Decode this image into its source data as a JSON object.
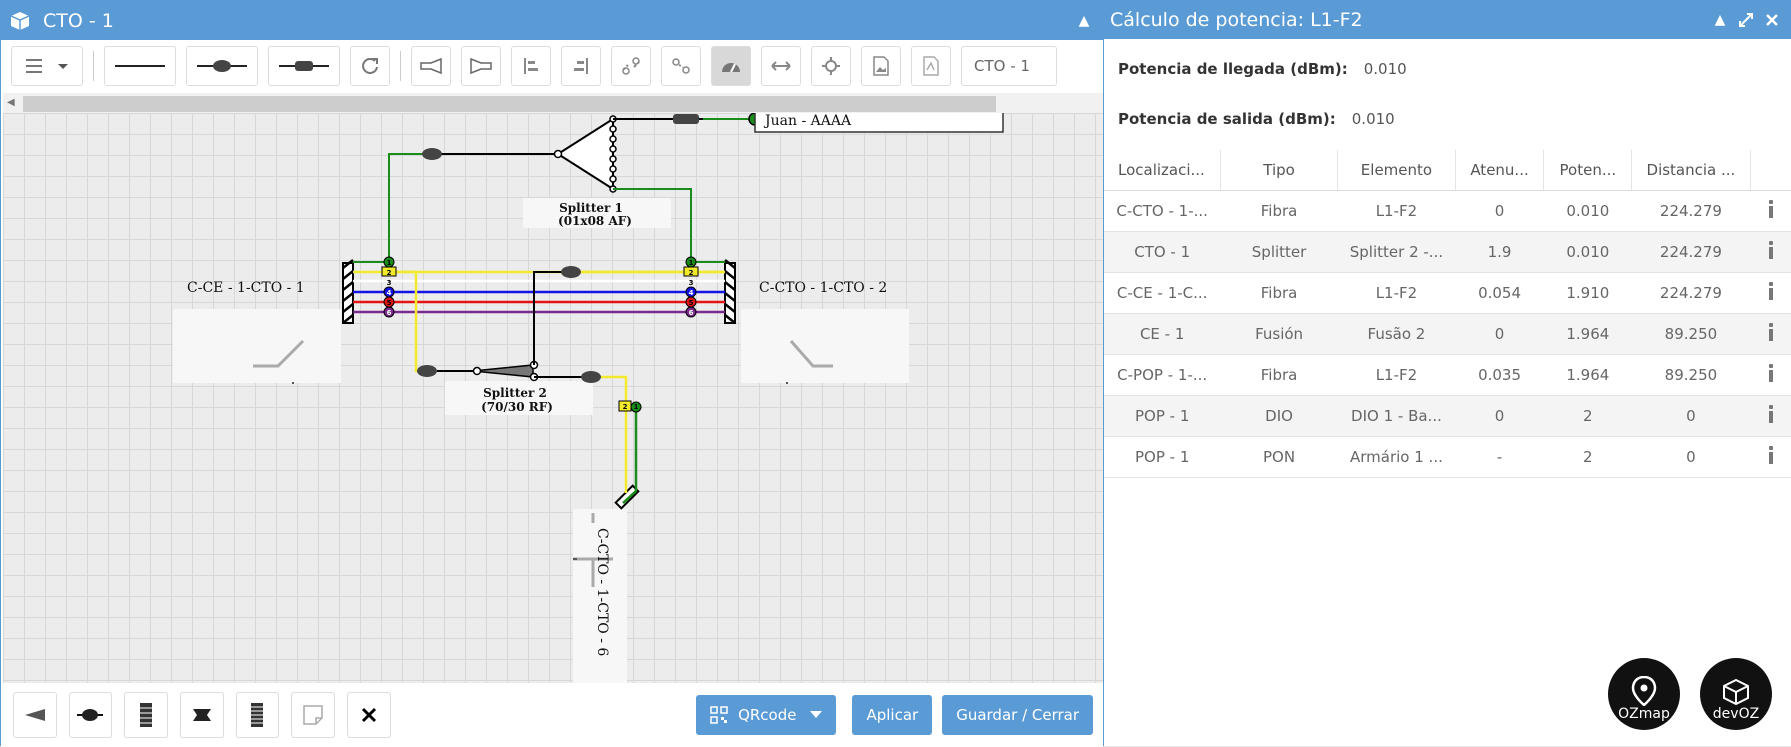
{
  "left_window": {
    "title": "CTO - 1",
    "toolbar": {
      "selector_value": "CTO - 1"
    },
    "diagram": {
      "labels": {
        "output_client": "Juan - AAAA",
        "splitter1_name": "Splitter 1",
        "splitter1_type": "(01x08 AF)",
        "splitter2_name": "Splitter 2",
        "splitter2_type": "(70/30 RF)",
        "cable_left": "C-CE - 1-CTO - 1",
        "cable_right": "C-CTO - 1-CTO - 2",
        "cable_bottom": "C-CTO - 1-CTO - 6"
      },
      "fiber_numbers": [
        "1",
        "2",
        "3",
        "4",
        "5",
        "6"
      ]
    },
    "bottom": {
      "qrcode_label": "QRcode",
      "apply_label": "Aplicar",
      "save_close_label": "Guardar / Cerrar"
    }
  },
  "right_window": {
    "title": "Cálculo de potencia: L1-F2",
    "arrival_label": "Potencia de llegada (dBm):",
    "arrival_value": "0.010",
    "output_label": "Potencia de salida (dBm):",
    "output_value": "0.010",
    "columns": [
      "Localizaci...",
      "Tipo",
      "Elemento",
      "Atenu...",
      "Poten...",
      "Distancia ..."
    ],
    "rows": [
      [
        "C-CTO - 1-...",
        "Fibra",
        "L1-F2",
        "0",
        "0.010",
        "224.279"
      ],
      [
        "CTO - 1",
        "Splitter",
        "Splitter 2 -...",
        "1.9",
        "0.010",
        "224.279"
      ],
      [
        "C-CE - 1-C...",
        "Fibra",
        "L1-F2",
        "0.054",
        "1.910",
        "224.279"
      ],
      [
        "CE - 1",
        "Fusión",
        "Fusão 2",
        "0",
        "1.964",
        "89.250"
      ],
      [
        "C-POP - 1-...",
        "Fibra",
        "L1-F2",
        "0.035",
        "1.964",
        "89.250"
      ],
      [
        "POP - 1",
        "DIO",
        "DIO 1 - Ba...",
        "0",
        "2",
        "0"
      ],
      [
        "POP - 1",
        "PON",
        "Armário 1 ...",
        "-",
        "2",
        "0"
      ]
    ],
    "logos": {
      "ozmap": "OZmap",
      "devoz": "devOZ"
    }
  },
  "colors": {
    "titlebar": "#5b9bd5",
    "fiber_green": "#1a8c1a",
    "fiber_yellow": "#f2ea2a",
    "fiber_blue": "#1414e6",
    "fiber_red": "#e61414",
    "fiber_purple": "#7a2a8c"
  }
}
